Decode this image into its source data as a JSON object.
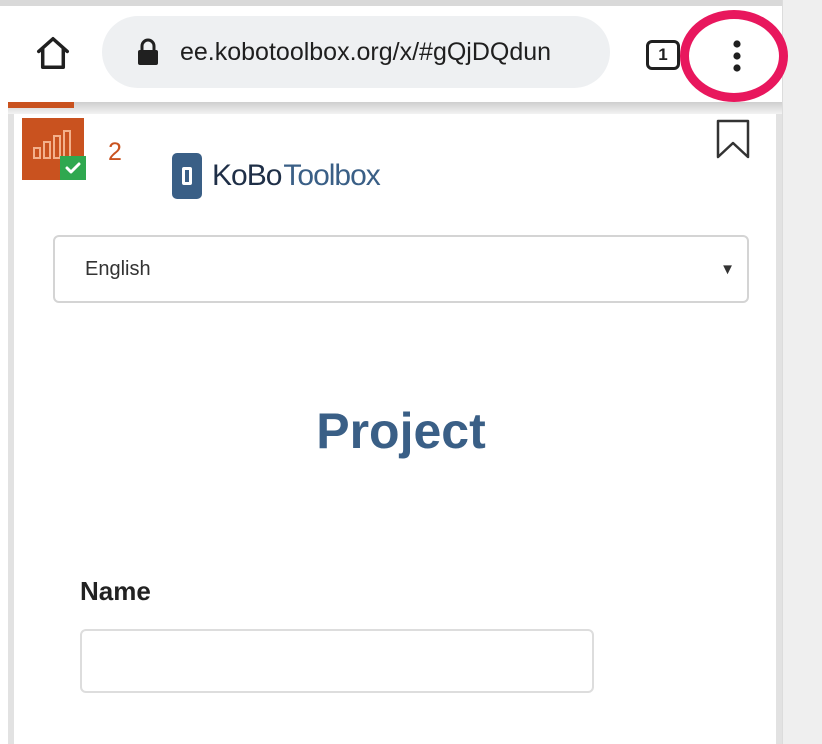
{
  "browser": {
    "url": "ee.kobotoolbox.org/x/#gQjDQdun",
    "tab_count": "1"
  },
  "page": {
    "badge_count": "2",
    "logo": {
      "part1": "KoBo",
      "part2": "Toolbox"
    },
    "language": {
      "selected": "English"
    },
    "title": "Project",
    "fields": [
      {
        "label": "Name",
        "value": ""
      }
    ]
  },
  "colors": {
    "highlight": "#e8175d",
    "brand_orange": "#c9521f",
    "brand_blue": "#3a5f86",
    "check_green": "#2fa84f"
  },
  "icons": {
    "home": "home-icon",
    "lock": "lock-icon",
    "tabs": "tab-switcher-icon",
    "menu": "more-vertical-icon",
    "app": "bar-chart-icon",
    "check": "checkmark-icon",
    "bookmark": "bookmark-icon",
    "caret": "caret-down-icon"
  }
}
